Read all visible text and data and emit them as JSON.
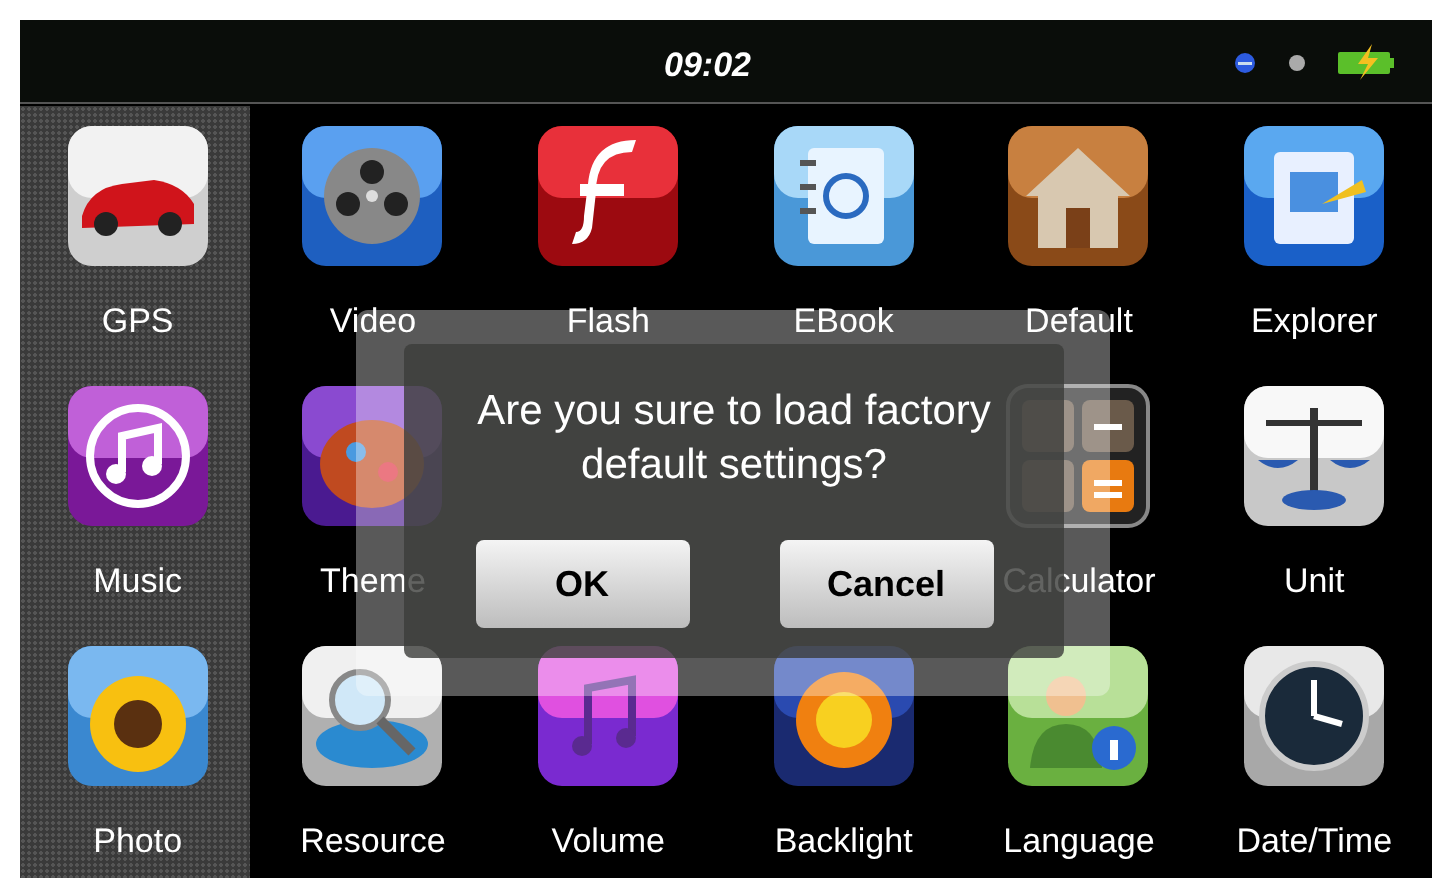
{
  "status_bar": {
    "time": "09:02"
  },
  "apps": [
    {
      "label": "GPS"
    },
    {
      "label": "Video"
    },
    {
      "label": "Flash"
    },
    {
      "label": "EBook"
    },
    {
      "label": "Default"
    },
    {
      "label": "Explorer"
    },
    {
      "label": "Music"
    },
    {
      "label": "Theme"
    },
    {
      "label": "Calculator"
    },
    {
      "label": "Unit"
    },
    {
      "label": "Photo"
    },
    {
      "label": "Resource"
    },
    {
      "label": "Volume"
    },
    {
      "label": "Backlight"
    },
    {
      "label": "Language"
    },
    {
      "label": "Date/Time"
    }
  ],
  "dialog": {
    "message": "Are you sure to load factory default settings?",
    "buttons": [
      "OK",
      "Cancel"
    ]
  }
}
